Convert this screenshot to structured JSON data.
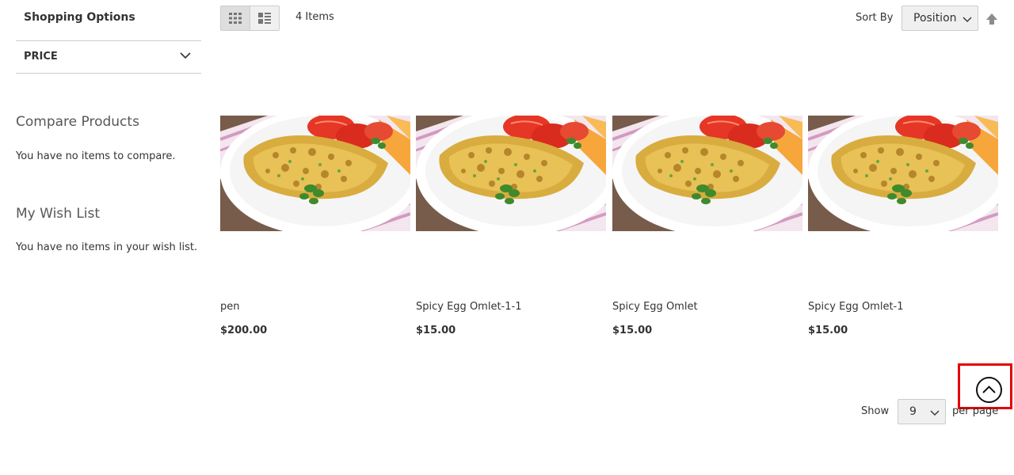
{
  "sidebar": {
    "filter_title": "Shopping Options",
    "filter_label": "PRICE",
    "compare_heading": "Compare Products",
    "compare_empty": "You have no items to compare.",
    "wishlist_heading": "My Wish List",
    "wishlist_empty": "You have no items in your wish list."
  },
  "toolbar": {
    "view_modes": [
      "grid-icon",
      "list-icon"
    ],
    "active_mode": "grid",
    "amount": "4 Items",
    "sort_label": "Sort By",
    "sort_value": "Position",
    "sort_direction": "ascending"
  },
  "products": [
    {
      "name": "pen",
      "price": "$200.00"
    },
    {
      "name": "Spicy Egg Omlet-1-1",
      "price": "$15.00"
    },
    {
      "name": "Spicy Egg Omlet",
      "price": "$15.00"
    },
    {
      "name": "Spicy Egg Omlet-1",
      "price": "$15.00"
    }
  ],
  "limiter": {
    "show_label": "Show",
    "value": "9",
    "per_page_label": "per page"
  },
  "colors": {
    "text": "#333333",
    "border": "#cccccc",
    "control_bg": "#f0f0f0",
    "highlight": "#e50000"
  }
}
